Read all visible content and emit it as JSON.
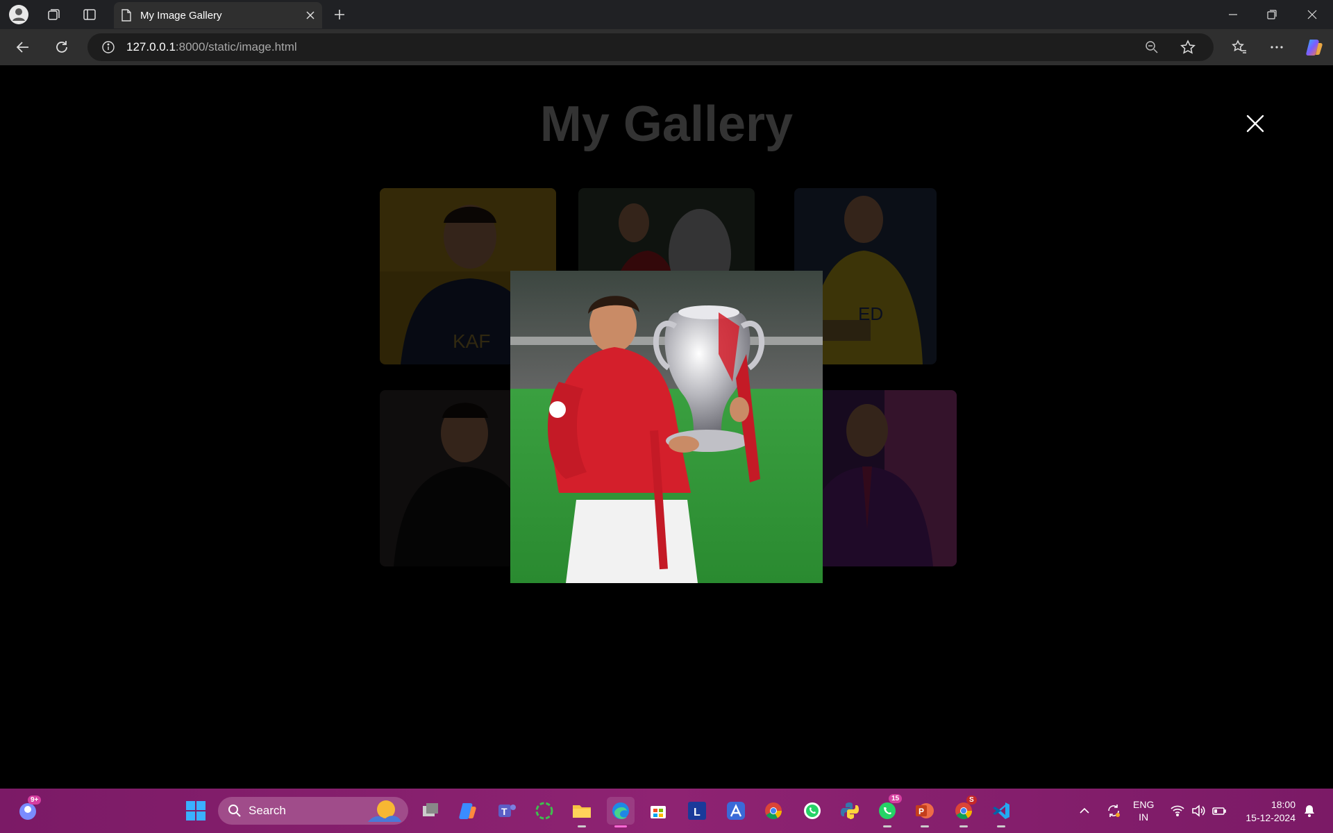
{
  "browser": {
    "tab_title": "My Image Gallery",
    "url_host": "127.0.0.1",
    "url_rest": ":8000/static/image.html"
  },
  "page": {
    "title": "My Gallery",
    "close_symbol": "✕",
    "thumbnails": [
      {
        "name": "thumb-blue-kit"
      },
      {
        "name": "thumb-trophy"
      },
      {
        "name": "thumb-yellow-kit"
      },
      {
        "name": "thumb-dark-suit"
      },
      {
        "name": "thumb-purple-suit"
      }
    ],
    "modal_image": "trophy-photo"
  },
  "taskbar": {
    "search_label": "Search",
    "chat_badge": "9+",
    "whatsapp_badge": "15",
    "chrome_badge": "S",
    "lang_line1": "ENG",
    "lang_line2": "IN",
    "time": "18:00",
    "date": "15-12-2024"
  },
  "colors": {
    "taskbar": "#8a1d6e",
    "page_bg": "#000000",
    "title": "#333333"
  }
}
